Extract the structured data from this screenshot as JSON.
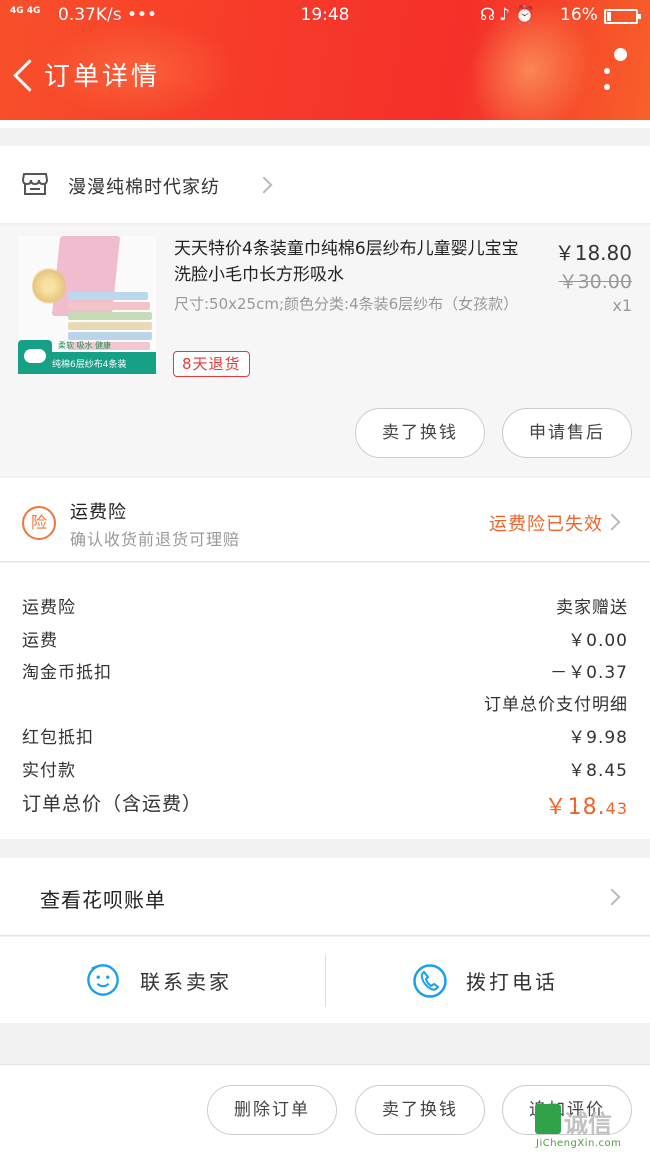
{
  "status_bar": {
    "signal": "4G 4G",
    "net_speed": "0.37K/s •••",
    "time": "19:48",
    "icons": "☊♪⏰",
    "battery_percent": "16%",
    "battery_level": 0.16
  },
  "header": {
    "title": "订单详情"
  },
  "shop": {
    "name": "漫漫纯棉时代家纺"
  },
  "product": {
    "title": "天天特价4条装童巾纯棉6层纱布儿童婴儿宝宝洗脸小毛巾长方形吸水",
    "spec": "尺寸:50x25cm;颜色分类:4条装6层纱布（女孩款）",
    "price": "￥18.80",
    "original_price": "￥30.00",
    "quantity": "x1",
    "return_tag": "8天退货",
    "thumb_band_text": "纯棉6层纱布4条装",
    "thumb_top_text": "柔软 吸水 健康",
    "buttons": {
      "sell": "卖了换钱",
      "after_sale": "申请售后"
    }
  },
  "insurance": {
    "badge": "险",
    "title": "运费险",
    "subtitle": "确认收货前退货可理赔",
    "status": "运费险已失效"
  },
  "costs": {
    "rows": [
      {
        "label": "运费险",
        "value": "卖家赠送"
      },
      {
        "label": "运费",
        "value": "￥0.00"
      },
      {
        "label": "淘金币抵扣",
        "value": "－￥0.37"
      },
      {
        "label": "",
        "value": "订单总价支付明细"
      },
      {
        "label": "红包抵扣",
        "value": "￥9.98"
      },
      {
        "label": "实付款",
        "value": "￥8.45"
      }
    ],
    "total_label": "订单总价（含运费）",
    "total_main": "￥18.",
    "total_cents": "43"
  },
  "huabei": {
    "label": "查看花呗账单"
  },
  "contact": {
    "seller": "联系卖家",
    "phone": "拨打电话"
  },
  "bottom_bar": {
    "delete": "删除订单",
    "sell": "卖了换钱",
    "review": "追加评价"
  },
  "watermark": {
    "cn": "诚信",
    "en": "JiChengXin.com"
  },
  "colors": {
    "accent": "#f0642c",
    "header": "#f5302a",
    "link_blue": "#1a9ef0"
  }
}
